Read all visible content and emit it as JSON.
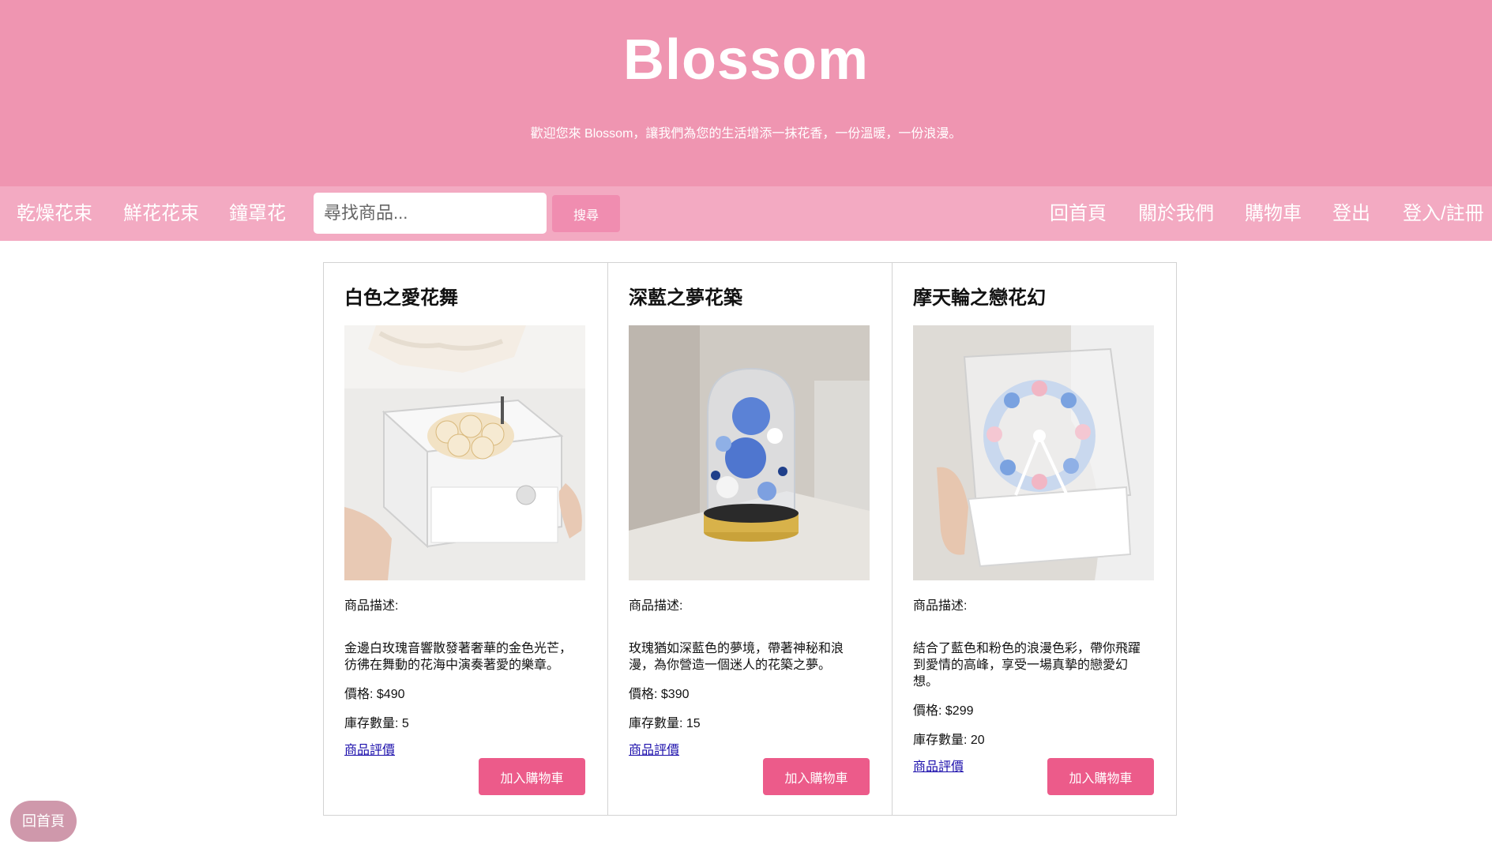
{
  "header": {
    "title": "Blossom",
    "subtitle": "歡迎您來 Blossom，讓我們為您的生活增添一抹花香，一份溫暖，一份浪漫。"
  },
  "nav": {
    "left_links": [
      "乾燥花束",
      "鮮花花束",
      "鐘罩花"
    ],
    "search_placeholder": "尋找商品...",
    "search_button": "搜尋",
    "right_links": [
      "回首頁",
      "關於我們",
      "購物車",
      "登出",
      "登入/註冊"
    ]
  },
  "products": [
    {
      "name": "白色之愛花舞",
      "desc_label": "商品描述:",
      "description": "金邊白玫瑰音響散發著奢華的金色光芒，彷彿在舞動的花海中演奏著愛的樂章。",
      "price": "價格: $490",
      "stock": "庫存數量: 5",
      "review_link": "商品評價",
      "cart_button": "加入購物車"
    },
    {
      "name": "深藍之夢花築",
      "desc_label": "商品描述:",
      "description": "玫瑰猶如深藍色的夢境，帶著神秘和浪漫，為你營造一個迷人的花築之夢。",
      "price": "價格: $390",
      "stock": "庫存數量: 15",
      "review_link": "商品評價",
      "cart_button": "加入購物車"
    },
    {
      "name": "摩天輪之戀花幻",
      "desc_label": "商品描述:",
      "description": "結合了藍色和粉色的浪漫色彩，帶你飛躍到愛情的高峰，享受一場真摯的戀愛幻想。",
      "price": "價格: $299",
      "stock": "庫存數量: 20",
      "review_link": "商品評價",
      "cart_button": "加入購物車"
    }
  ],
  "floating": {
    "home_button": "回首頁"
  },
  "colors": {
    "header_bg": "#ef95b1",
    "nav_bg": "#f3aac2",
    "search_button_bg": "#f08db0",
    "cart_button_bg": "#ec5b8a",
    "floating_button_bg": "#cf98ab"
  },
  "images": {
    "product_1": "photo: white flower music box in acrylic case held by hands",
    "product_2": "photo: blue preserved roses in glass dome with gold base",
    "product_3": "photo: ferris wheel of blue and pink flowers in acrylic box"
  }
}
